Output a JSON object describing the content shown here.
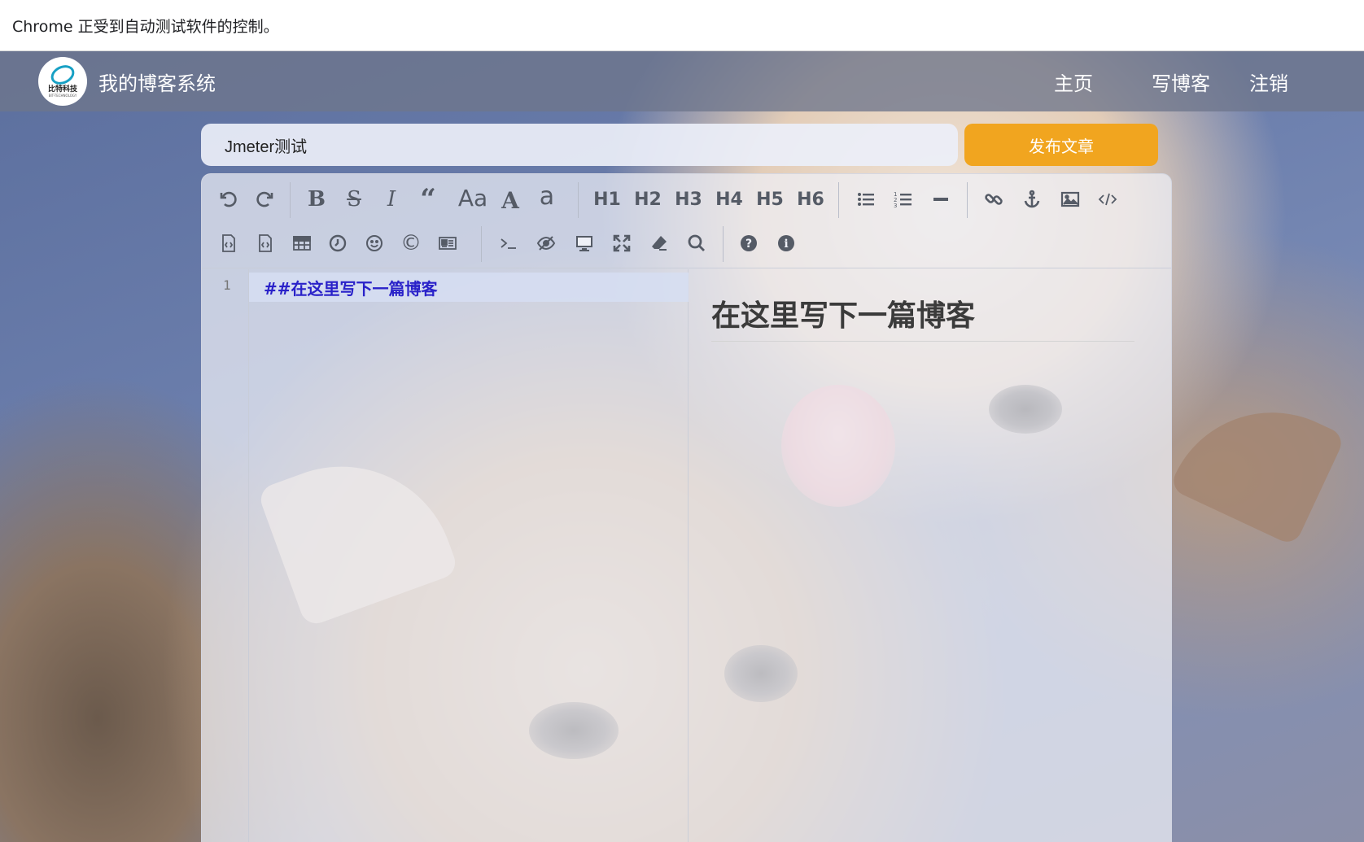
{
  "browser": {
    "infobar_text": "Chrome 正受到自动测试软件的控制。"
  },
  "navbar": {
    "logo_text": "比特科技",
    "logo_sub": "BIT-TECHNOLOGY",
    "site_title": "我的博客系统",
    "links": {
      "home": "主页",
      "write": "写博客",
      "logout": "注销"
    }
  },
  "editor_form": {
    "title_value": "Jmeter测试",
    "publish_label": "发布文章"
  },
  "toolbar": {
    "heading_labels": {
      "h1": "H1",
      "h2": "H2",
      "h3": "H3",
      "h4": "H4",
      "h5": "H5",
      "h6": "H6"
    },
    "case_labels": {
      "ucfirst": "Aa",
      "upper": "A",
      "lower": "a"
    }
  },
  "editor": {
    "line_number": "1",
    "code_line": "##在这里写下一篇博客",
    "preview_heading": "在这里写下一篇博客"
  },
  "colors": {
    "publish": "#f1a51f",
    "code_text": "#2a22c9"
  }
}
